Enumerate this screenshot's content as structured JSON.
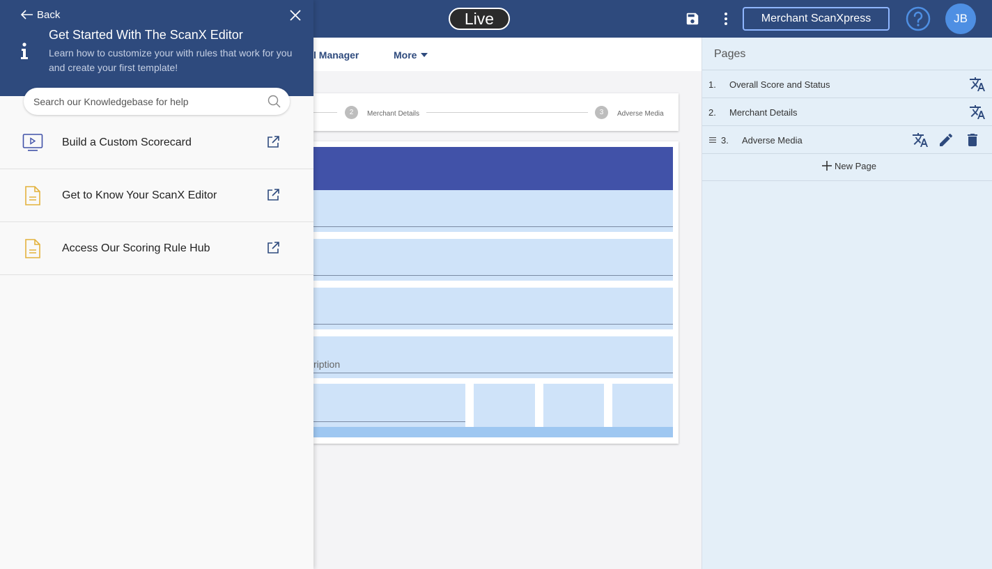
{
  "topbar": {
    "status_label": "Live",
    "save_icon": "save-icon",
    "more_icon": "kebab-icon",
    "workspace_button": "Merchant ScanXpress",
    "help_icon": "help-icon",
    "avatar_initials": "JB",
    "colors": {
      "bar": "#2e4a7d",
      "avatar": "#4e8fe3"
    }
  },
  "subnav": {
    "items": [
      {
        "label": "l Manager"
      },
      {
        "label": "More"
      }
    ]
  },
  "stepper": {
    "steps": [
      {
        "number": "2",
        "label": "Merchant Details"
      },
      {
        "number": "3",
        "label": "Adverse Media"
      }
    ]
  },
  "document": {
    "description_fragment": "ription",
    "colors": {
      "header": "#4152a8",
      "block": "#cfe3f9",
      "footer": "#9ec7f1"
    }
  },
  "pages_panel": {
    "title": "Pages",
    "pages": [
      {
        "number": "1.",
        "name": "Overall Score and Status"
      },
      {
        "number": "2.",
        "name": "Merchant Details"
      },
      {
        "number": "3.",
        "name": "Adverse Media"
      }
    ],
    "new_page_label": "New Page"
  },
  "help_panel": {
    "back_label": "Back",
    "title": "Get Started With The ScanX Editor",
    "subtitle": "Learn how to customize your with rules that work for you and create your first template!",
    "search_placeholder": "Search our Knowledgebase for help",
    "items": [
      {
        "label": "Build a Custom Scorecard",
        "icon": "video-icon"
      },
      {
        "label": "Get to Know Your ScanX Editor",
        "icon": "document-icon"
      },
      {
        "label": "Access Our Scoring Rule Hub",
        "icon": "document-icon"
      }
    ]
  }
}
